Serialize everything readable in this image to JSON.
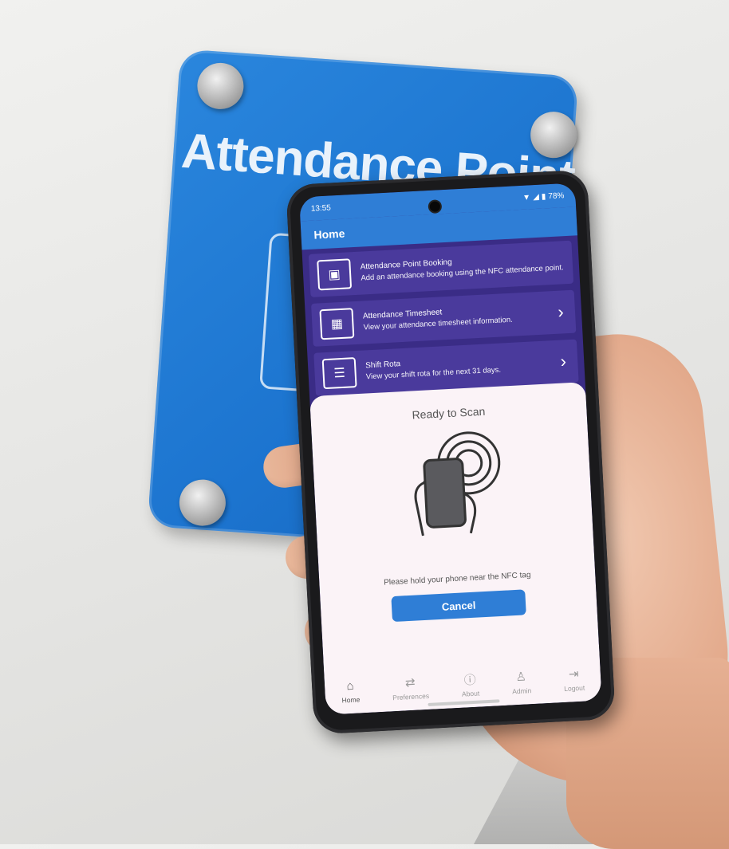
{
  "sign": {
    "title": "Attendance Point"
  },
  "status_bar": {
    "time": "13:55",
    "battery": "78%"
  },
  "app_bar": {
    "title": "Home"
  },
  "menu": {
    "items": [
      {
        "title": "Attendance Point Booking",
        "description": "Add an attendance booking using the NFC attendance point.",
        "icon": "nfc-tag-icon",
        "has_chevron": false
      },
      {
        "title": "Attendance Timesheet",
        "description": "View your attendance timesheet information.",
        "icon": "timesheet-icon",
        "has_chevron": true
      },
      {
        "title": "Shift Rota",
        "description": "View your shift rota for the next 31 days.",
        "icon": "gantt-icon",
        "has_chevron": true
      }
    ]
  },
  "nfc_sheet": {
    "title": "Ready to Scan",
    "message": "Please hold your phone near the NFC tag",
    "cancel_label": "Cancel"
  },
  "bottom_nav": {
    "items": [
      {
        "label": "Home",
        "icon": "home-icon"
      },
      {
        "label": "Preferences",
        "icon": "preferences-icon"
      },
      {
        "label": "About",
        "icon": "info-icon"
      },
      {
        "label": "Admin",
        "icon": "admin-icon"
      },
      {
        "label": "Logout",
        "icon": "logout-icon"
      }
    ]
  },
  "colors": {
    "accent": "#2f7ed6",
    "card": "#4a3a9c",
    "sign": "#1c74cf"
  }
}
